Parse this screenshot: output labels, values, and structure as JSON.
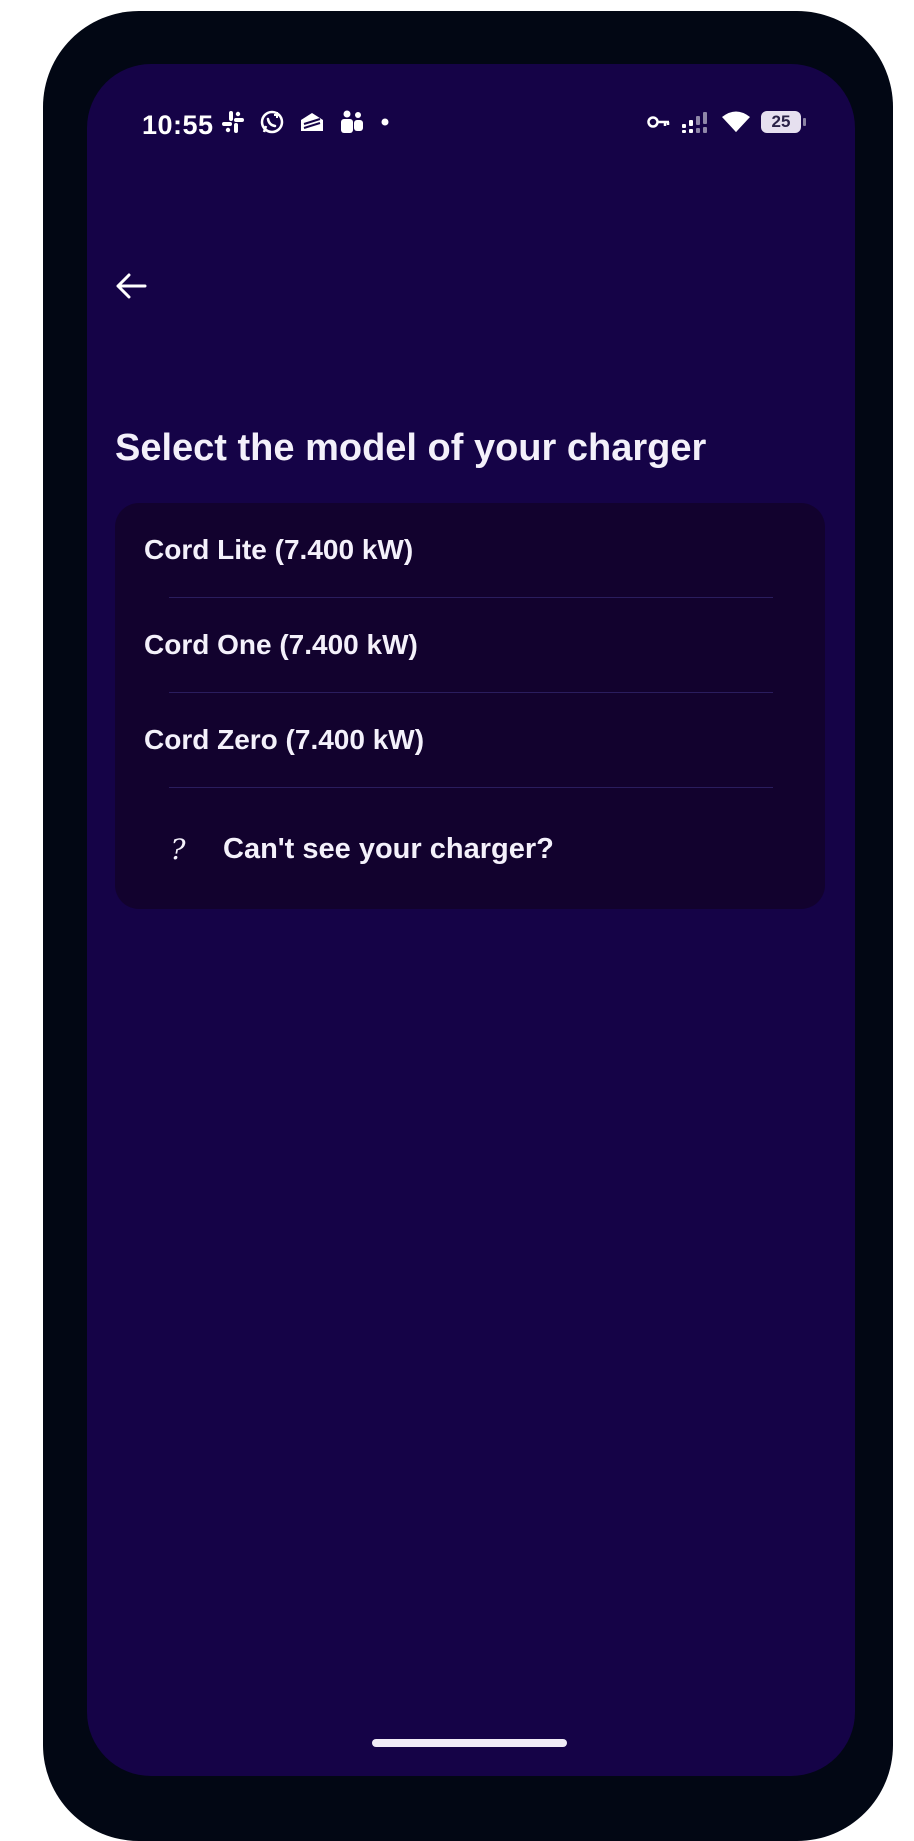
{
  "status_bar": {
    "time": "10:55",
    "left_icons": [
      "slack-icon",
      "whatsapp-icon",
      "inbox-icon",
      "teams-icon",
      "dot-icon"
    ],
    "right_icons": [
      "vpn-key-icon",
      "signal-icon",
      "wifi-icon",
      "battery-icon"
    ],
    "battery_level": "25"
  },
  "header": {
    "back_icon": "arrow-left-icon"
  },
  "main": {
    "title": "Select the model of your charger",
    "options": [
      {
        "label": "Cord Lite (7.400 kW)"
      },
      {
        "label": "Cord One (7.400 kW)"
      },
      {
        "label": "Cord Zero (7.400 kW)"
      }
    ],
    "help": {
      "icon": "question-mark-icon",
      "glyph": "?",
      "label": "Can't see your charger?"
    }
  },
  "colors": {
    "screen_background": "#150347",
    "card_background": "#12022e",
    "device_frame": "#020714",
    "text": "#f4f1fb",
    "divider": "#2a1d5e"
  }
}
